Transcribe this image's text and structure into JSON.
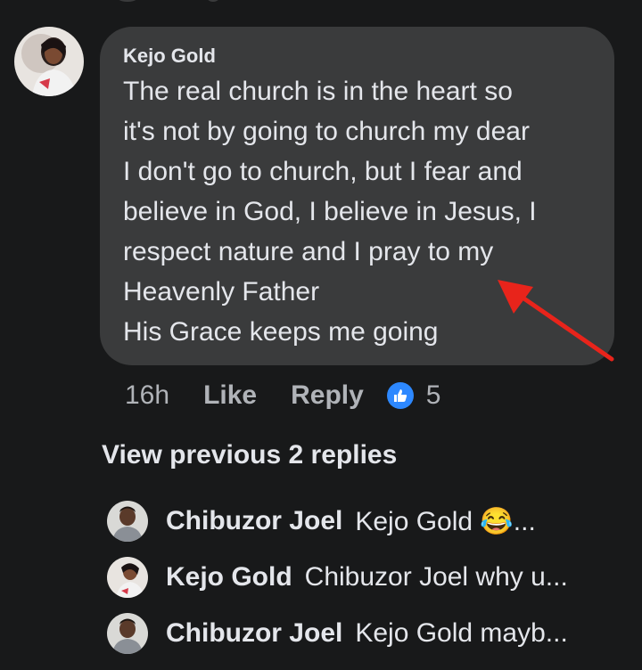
{
  "comment": {
    "author": "Kejo Gold",
    "text": "The real church is in the heart so\nit's not by going to church my dear\nI don't go to church, but I fear and\nbelieve in God, I believe in Jesus, I\nrespect nature and I pray to my\nHeavenly Father\nHis Grace keeps me going",
    "time": "16h",
    "like_label": "Like",
    "reply_label": "Reply",
    "reaction_count": "5"
  },
  "view_previous_label": "View previous 2 replies",
  "replies": [
    {
      "name": "Chibuzor Joel",
      "text": "Kejo Gold 😂..."
    },
    {
      "name": "Kejo Gold",
      "text": "Chibuzor Joel why u..."
    },
    {
      "name": "Chibuzor Joel",
      "text": "Kejo Gold mayb..."
    }
  ],
  "colors": {
    "background": "#18191a",
    "bubble": "#3a3b3c",
    "accent_like": "#2d88ff",
    "arrow": "#e8241b"
  }
}
